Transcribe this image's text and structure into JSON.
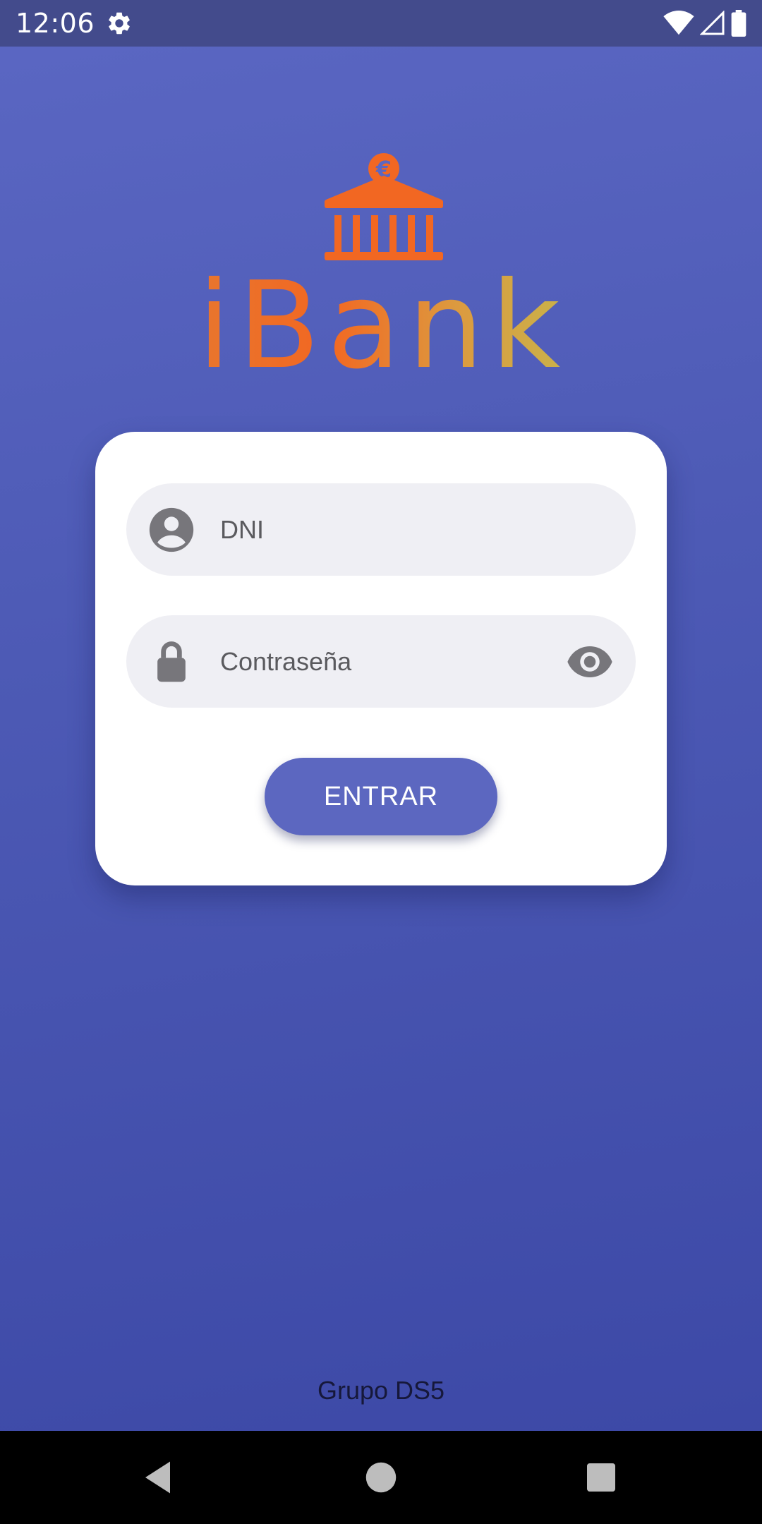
{
  "status_bar": {
    "time": "12:06",
    "icons": [
      "settings-gear-icon",
      "wifi-icon",
      "signal-icon",
      "battery-icon"
    ]
  },
  "logo": {
    "text": "iBank",
    "icon": "bank-euro-icon",
    "colors": [
      "#f26722",
      "#e58a36",
      "#c9b24a"
    ]
  },
  "login": {
    "dni_placeholder": "DNI",
    "password_placeholder": "Contraseña",
    "enter_label": "ENTRAR",
    "icons": {
      "dni": "user-account-icon",
      "password": "lock-icon",
      "toggle_visibility": "eye-icon"
    }
  },
  "footer": {
    "text": "Grupo DS5"
  },
  "navigation": {
    "buttons": [
      "back-icon",
      "home-icon",
      "recents-icon"
    ]
  },
  "colors": {
    "accent": "#5c67c0",
    "status_bar": "#434b8c",
    "logo_orange": "#f26722"
  }
}
